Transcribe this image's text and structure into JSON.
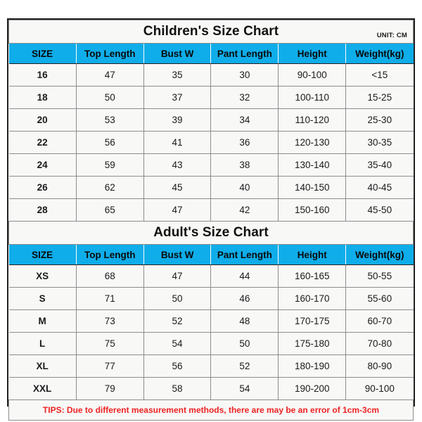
{
  "unit_note": "UNIT: CM",
  "columns": [
    "SIZE",
    "Top Length",
    "Bust W",
    "Pant Length",
    "Height",
    "Weight(kg)"
  ],
  "children": {
    "title": "Children's Size Chart",
    "rows": [
      {
        "size": "16",
        "top_length": "47",
        "bust_w": "35",
        "pant_length": "30",
        "height": "90-100",
        "weight": "<15"
      },
      {
        "size": "18",
        "top_length": "50",
        "bust_w": "37",
        "pant_length": "32",
        "height": "100-110",
        "weight": "15-25"
      },
      {
        "size": "20",
        "top_length": "53",
        "bust_w": "39",
        "pant_length": "34",
        "height": "110-120",
        "weight": "25-30"
      },
      {
        "size": "22",
        "top_length": "56",
        "bust_w": "41",
        "pant_length": "36",
        "height": "120-130",
        "weight": "30-35"
      },
      {
        "size": "24",
        "top_length": "59",
        "bust_w": "43",
        "pant_length": "38",
        "height": "130-140",
        "weight": "35-40"
      },
      {
        "size": "26",
        "top_length": "62",
        "bust_w": "45",
        "pant_length": "40",
        "height": "140-150",
        "weight": "40-45"
      },
      {
        "size": "28",
        "top_length": "65",
        "bust_w": "47",
        "pant_length": "42",
        "height": "150-160",
        "weight": "45-50"
      }
    ]
  },
  "adult": {
    "title": "Adult's Size Chart",
    "rows": [
      {
        "size": "XS",
        "top_length": "68",
        "bust_w": "47",
        "pant_length": "44",
        "height": "160-165",
        "weight": "50-55"
      },
      {
        "size": "S",
        "top_length": "71",
        "bust_w": "50",
        "pant_length": "46",
        "height": "160-170",
        "weight": "55-60"
      },
      {
        "size": "M",
        "top_length": "73",
        "bust_w": "52",
        "pant_length": "48",
        "height": "170-175",
        "weight": "60-70"
      },
      {
        "size": "L",
        "top_length": "75",
        "bust_w": "54",
        "pant_length": "50",
        "height": "175-180",
        "weight": "70-80"
      },
      {
        "size": "XL",
        "top_length": "77",
        "bust_w": "56",
        "pant_length": "52",
        "height": "180-190",
        "weight": "80-90"
      },
      {
        "size": "XXL",
        "top_length": "79",
        "bust_w": "58",
        "pant_length": "54",
        "height": "190-200",
        "weight": "90-100"
      }
    ]
  },
  "tips": "TIPS: Due to different measurement methods, there are may be an error of 1cm-3cm",
  "colors": {
    "header_blue": "#0fade9",
    "tips_red": "#ee2222",
    "border_dark": "#231f20",
    "cell_bg": "#f8f8f7"
  }
}
